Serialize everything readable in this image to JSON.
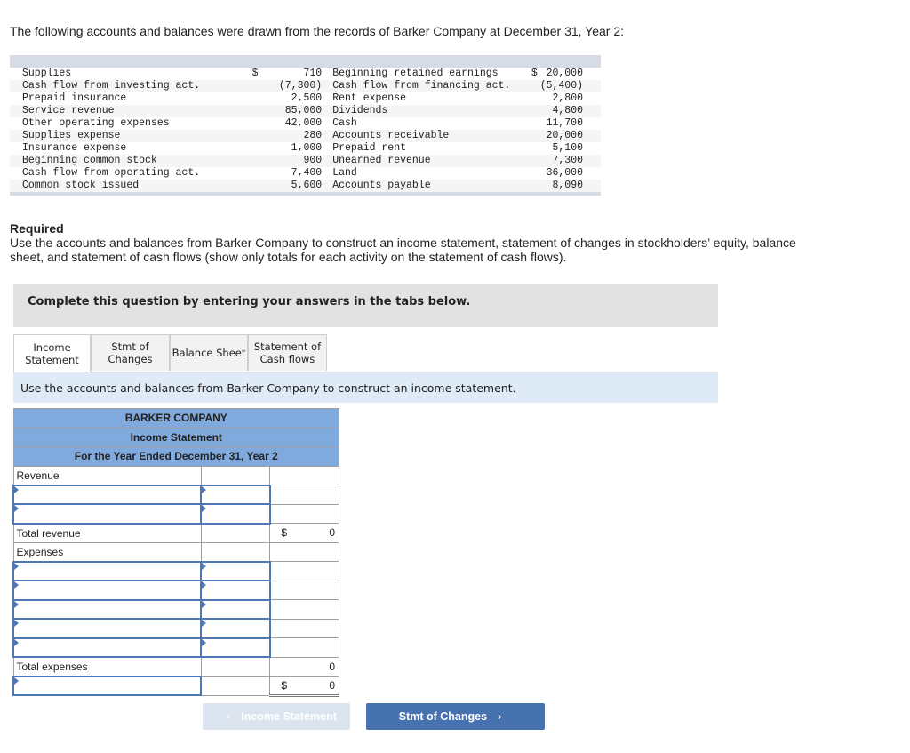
{
  "intro": "The following accounts and balances were drawn from the records of Barker Company at December 31, Year 2:",
  "accounts": [
    {
      "left_label": "Supplies",
      "left_currency": "$",
      "left_value": "710",
      "right_label": "Beginning retained earnings",
      "right_currency": "$",
      "right_value": "20,000"
    },
    {
      "left_label": "Cash flow from investing act.",
      "left_currency": "",
      "left_value": "(7,300)",
      "right_label": "Cash flow from financing act.",
      "right_currency": "",
      "right_value": "(5,400)"
    },
    {
      "left_label": "Prepaid insurance",
      "left_currency": "",
      "left_value": "2,500",
      "right_label": "Rent expense",
      "right_currency": "",
      "right_value": "2,800"
    },
    {
      "left_label": "Service revenue",
      "left_currency": "",
      "left_value": "85,000",
      "right_label": "Dividends",
      "right_currency": "",
      "right_value": "4,800"
    },
    {
      "left_label": "Other operating expenses",
      "left_currency": "",
      "left_value": "42,000",
      "right_label": "Cash",
      "right_currency": "",
      "right_value": "11,700"
    },
    {
      "left_label": "Supplies expense",
      "left_currency": "",
      "left_value": "280",
      "right_label": "Accounts receivable",
      "right_currency": "",
      "right_value": "20,000"
    },
    {
      "left_label": "Insurance expense",
      "left_currency": "",
      "left_value": "1,000",
      "right_label": "Prepaid rent",
      "right_currency": "",
      "right_value": "5,100"
    },
    {
      "left_label": "Beginning common stock",
      "left_currency": "",
      "left_value": "900",
      "right_label": "Unearned revenue",
      "right_currency": "",
      "right_value": "7,300"
    },
    {
      "left_label": "Cash flow from operating act.",
      "left_currency": "",
      "left_value": "7,400",
      "right_label": "Land",
      "right_currency": "",
      "right_value": "36,000"
    },
    {
      "left_label": "Common stock issued",
      "left_currency": "",
      "left_value": "5,600",
      "right_label": "Accounts payable",
      "right_currency": "",
      "right_value": "8,090"
    }
  ],
  "required": {
    "heading": "Required",
    "text": "Use the accounts and balances from Barker Company to construct an income statement, statement of changes in stockholders’ equity, balance sheet, and statement of cash flows (show only totals for each activity on the statement of cash flows)."
  },
  "complete_prompt": "Complete this question by entering your answers in the tabs below.",
  "tabs": [
    {
      "line1": "Income",
      "line2": "Statement",
      "active": true
    },
    {
      "line1": "Stmt of",
      "line2": "Changes",
      "active": false
    },
    {
      "line1": "Balance Sheet",
      "line2": "",
      "active": false
    },
    {
      "line1": "Statement of",
      "line2": "Cash flows",
      "active": false
    }
  ],
  "instruction": "Use the accounts and balances from Barker Company to construct an income statement.",
  "worksheet": {
    "company": "BARKER COMPANY",
    "title": "Income Statement",
    "period": "For the Year Ended December 31, Year 2",
    "revenue_label": "Revenue",
    "total_revenue_label": "Total revenue",
    "total_revenue_currency": "$",
    "total_revenue_value": "0",
    "expenses_label": "Expenses",
    "total_expenses_label": "Total expenses",
    "total_expenses_value": "0",
    "net_currency": "$",
    "net_value": "0"
  },
  "nav": {
    "prev_label": "Income Statement",
    "next_label": "Stmt of Changes",
    "prev_icon": "‹",
    "next_icon": "›"
  }
}
